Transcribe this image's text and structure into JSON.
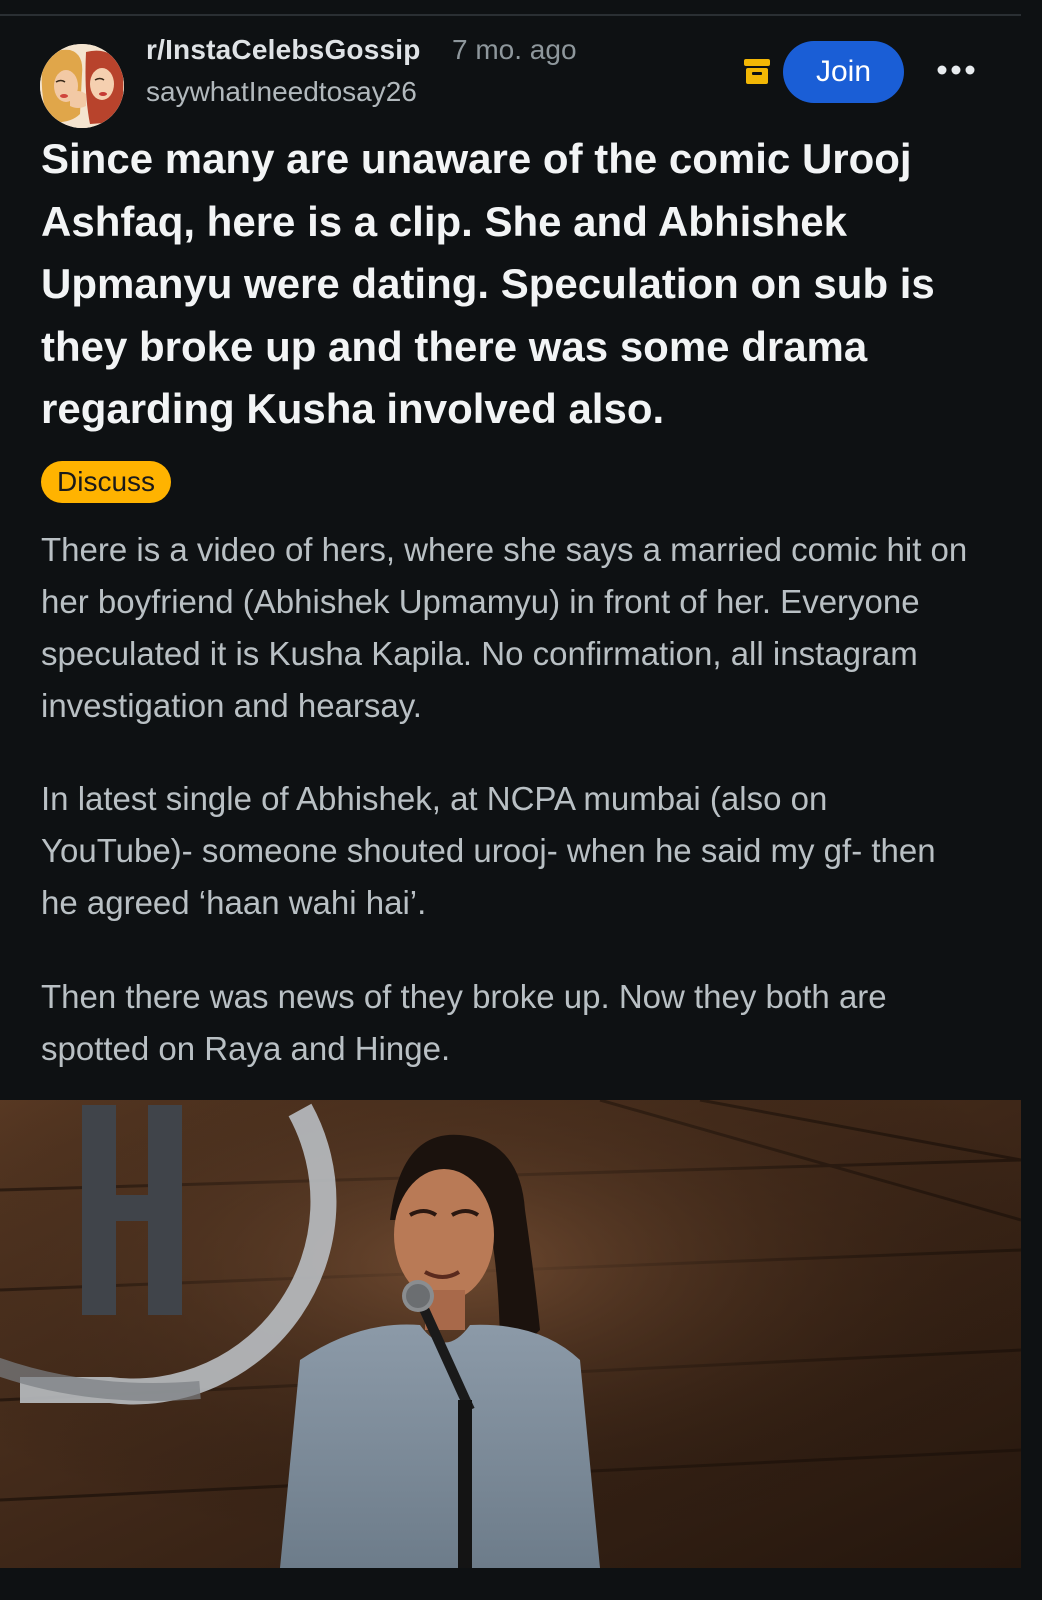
{
  "post": {
    "subreddit": "r/InstaCelebsGossip",
    "time": "7 mo. ago",
    "username": "saywhatIneedtosay26",
    "join_label": "Join",
    "title": "Since many are unaware of the comic Urooj Ashfaq, here is a clip. She and Abhishek Upmanyu were dating. Speculation on sub is they broke up and there was some drama regarding Kusha involved also.",
    "flair": "Discuss",
    "body": [
      "There is a video of hers, where she says a married comic hit on her boyfriend (Abhishek Upmamyu) in front of her. Everyone speculated it is Kusha Kapila. No confirmation, all instagram investigation and hearsay.",
      "In latest single of Abhishek, at NCPA mumbai (also on YouTube)- someone shouted urooj- when he said my gf- then he agreed ‘haan wahi hai’.",
      "Then there was news of they broke up. Now they both are spotted on Raya and Hinge."
    ]
  },
  "icons": {
    "archive": "archive-icon",
    "more": "more-options-icon",
    "avatar": "subreddit-avatar"
  },
  "colors": {
    "background": "#0e1113",
    "join_button": "#1a5ed6",
    "flair": "#ffb300",
    "archive_icon": "#f2b705"
  }
}
